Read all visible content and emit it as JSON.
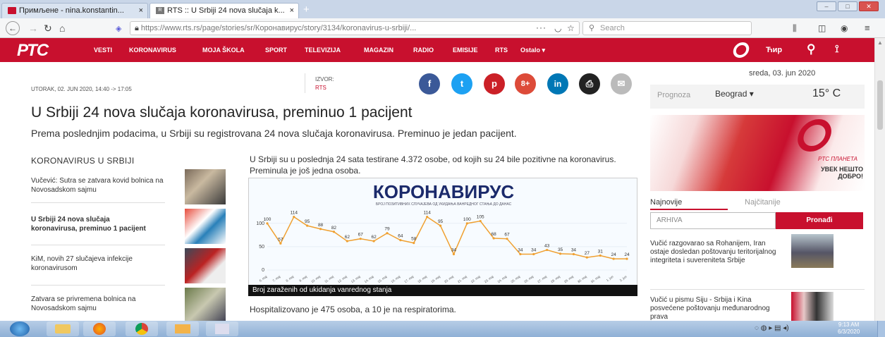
{
  "browser": {
    "tabs": [
      {
        "title": "Примљене - nina.konstantin...",
        "close": "×"
      },
      {
        "title": "RTS :: U Srbiji 24 nova slučaja k...",
        "close": "×"
      }
    ],
    "new_tab": "+",
    "url": "https://www.rts.rs/page/stories/sr/Коронавирус/story/3134/koronavirus-u-srbiji/...",
    "search_placeholder": "Search",
    "more": "···"
  },
  "site": {
    "logo": "РТС",
    "nav": [
      "VESTI",
      "KORONAVIRUS",
      "MOJA ŠKOLA",
      "SPORT",
      "TELEVIZIJA",
      "MAGAZIN",
      "RADIO",
      "EMISIJE",
      "RTS",
      "Ostalo ▾"
    ],
    "script_toggle": "Ћир"
  },
  "article": {
    "date": "UTORAK, 02. JUN 2020, 14:40 -> 17:05",
    "source_label": "IZVOR:",
    "source": "RTS",
    "headline": "U Srbiji 24 nova slučaja koronavirusa, preminuo 1 pacijent",
    "lead": "Prema poslednjim podacima, u Srbiji su registrovana 24 nova slučaja koronavirusa. Preminuo je jedan pacijent.",
    "body1": "U Srbiji su u poslednja 24 sata testirane 4.372 osobe, od kojih su 24 bile pozitivne na koronavirus. Preminula je još jedna osoba.",
    "body2": "Hospitalizovano je 475 osoba, a 10 je na respiratorima.",
    "share": [
      "f",
      "t",
      "p",
      "8+",
      "in",
      "⎙",
      "✉"
    ]
  },
  "related": {
    "title": "KORONAVIRUS U SRBIJI",
    "items": [
      "Vučević: Sutra se zatvara kovid bolnica na Novosadskom sajmu",
      "U Srbiji 24 nova slučaja koronavirusa, preminuo 1 pacijent",
      "KiM, novih 27 slučajeva infekcije koronavirusom",
      "Zatvara se privremena bolnica na Novosadskom sajmu"
    ]
  },
  "chart_data": {
    "type": "line",
    "title": "КОРОНАВИРУС",
    "subtitle": "БРОЈ ПОЗИТИВНИХ СЛУЧАЈЕВА ОД УКИДАЊА ВАНРЕДНОГ СТАЊА ДО ДАНАС",
    "caption": "Broj zaraženih od ukidanja vanrednog stanja",
    "y_ticks": [
      "100",
      "50",
      "0"
    ],
    "ylim": [
      0,
      130
    ],
    "categories": [
      "6. maj",
      "7. maj",
      "8. maj",
      "9. maj",
      "10. maj",
      "11. maj",
      "12. maj",
      "13. maj",
      "14. maj",
      "15. maj",
      "16. maj",
      "17. maj",
      "18. maj",
      "19. maj",
      "20. maj",
      "21. maj",
      "22. maj",
      "23. maj",
      "24. maj",
      "25. maj",
      "26. maj",
      "27. maj",
      "28. maj",
      "29. maj",
      "30. maj",
      "31. maj",
      "1. jun",
      "2. jun"
    ],
    "series": [
      {
        "values": [
          100,
          57,
          114,
          95,
          88,
          82,
          62,
          67,
          62,
          79,
          64,
          58,
          114,
          95,
          34,
          100,
          105,
          68,
          67,
          34,
          34,
          43,
          35,
          34,
          27,
          31,
          24,
          24
        ]
      }
    ]
  },
  "sidebar": {
    "date": "sreda, 03. jun 2020",
    "forecast_label": "Prognoza",
    "city": "Beograd",
    "temp": "15° C",
    "ad_brand": "PTC ПЛАНЕТА",
    "ad_text": "УВЕК НЕШТО ДОБРО!",
    "tabs": [
      "Najnovije",
      "Najčitanije"
    ],
    "archive_placeholder": "ARHIVA",
    "search_button": "Pronađi",
    "latest": [
      "Vučić razgovarao sa Rohanijem, Iran ostaje dosledan poštovanju teritorijalnog integriteta i suvereniteta Srbije",
      "Vučić u pismu Siju - Srbija i Kina posvećene poštovanju međunarodnog prava"
    ]
  },
  "taskbar": {
    "time": "9:13 AM",
    "date": "6/3/2020"
  },
  "colors": {
    "brand": "#c8102e",
    "chart_line": "#f0a030",
    "chart_label": "#2a8ad8"
  }
}
